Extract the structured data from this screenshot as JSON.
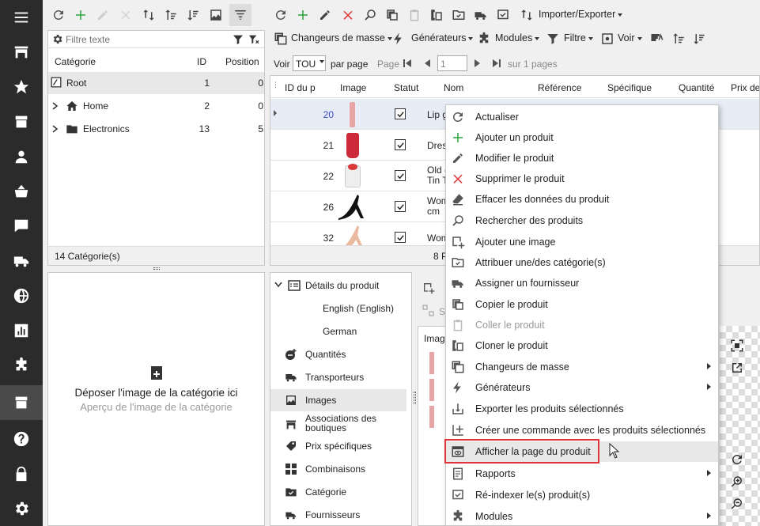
{
  "nav": {
    "items": [
      "menu-icon",
      "store-icon",
      "star-icon",
      "box-icon",
      "user-icon",
      "basket-icon",
      "chat-icon",
      "truck-icon",
      "globe-icon",
      "chart-icon",
      "puzzle-icon",
      "catalog-icon",
      "help-icon",
      "lock-icon",
      "gear-icon"
    ]
  },
  "category_panel": {
    "filter_placeholder": "Filtre texte",
    "columns": {
      "category": "Catégorie",
      "id": "ID",
      "position": "Position"
    },
    "rows": [
      {
        "name": "Root",
        "id": "1",
        "position": "0"
      },
      {
        "name": "Home",
        "id": "2",
        "position": "0"
      },
      {
        "name": "Electronics",
        "id": "13",
        "position": "5"
      }
    ],
    "footer": "14 Catégorie(s)"
  },
  "dropzone": {
    "title": "Déposer l'image de la catégorie ici",
    "subtitle": "Aperçu de l'image de la catégorie"
  },
  "toolbar": {
    "import_export": "Importer/Exporter",
    "mass_changers": "Changeurs de masse",
    "generators": "Générateurs",
    "modules": "Modules",
    "filter": "Filtre",
    "view": "Voir"
  },
  "pager": {
    "see_label": "Voir",
    "per_page_value": "TOU",
    "per_page_label": "par page",
    "page_label": "Page",
    "page_value": "1",
    "of_pages": "sur 1 pages"
  },
  "grid": {
    "columns": {
      "id": "ID du p",
      "image": "Image",
      "status": "Statut",
      "name": "Nom",
      "reference": "Référence",
      "specific": "Spécifique",
      "quantity": "Quantité",
      "price": "Prix de"
    },
    "rows": [
      {
        "id": "20",
        "name": "Lip g"
      },
      {
        "id": "21",
        "name": "Dres"
      },
      {
        "id": "22",
        "name": "Old (\nTin T"
      },
      {
        "id": "26",
        "name": "Wom\ncm"
      },
      {
        "id": "32",
        "name": "Wom"
      }
    ],
    "footer": "8 P"
  },
  "details": {
    "items": [
      "Détails du produit",
      "English (English)",
      "German",
      "Quantités",
      "Transporteurs",
      "Images",
      "Associations des\nboutiques",
      "Prix spécifiques",
      "Combinaisons",
      "Catégorie",
      "Fournisseurs"
    ]
  },
  "image_panel": {
    "header": "Imag",
    "sub_label": "S"
  },
  "context_menu": {
    "items": [
      {
        "label": "Actualiser",
        "icon": "refresh-icon",
        "submenu": false,
        "disabled": false
      },
      {
        "label": "Ajouter un produit",
        "icon": "plus-icon",
        "submenu": false,
        "disabled": false
      },
      {
        "label": "Modifier le produit",
        "icon": "pencil-icon",
        "submenu": false,
        "disabled": false
      },
      {
        "label": "Supprimer le produit",
        "icon": "delete-icon",
        "submenu": false,
        "disabled": false
      },
      {
        "label": "Effacer les données du produit",
        "icon": "eraser-icon",
        "submenu": false,
        "disabled": false
      },
      {
        "label": "Rechercher des produits",
        "icon": "search-icon",
        "submenu": false,
        "disabled": false
      },
      {
        "label": "Ajouter une image",
        "icon": "add-image-icon",
        "submenu": false,
        "disabled": false
      },
      {
        "label": "Attribuer une/des catégorie(s)",
        "icon": "category-assign-icon",
        "submenu": false,
        "disabled": false
      },
      {
        "label": "Assigner un fournisseur",
        "icon": "supplier-icon",
        "submenu": false,
        "disabled": false
      },
      {
        "label": "Copier le produit",
        "icon": "copy-icon",
        "submenu": false,
        "disabled": false
      },
      {
        "label": "Coller le produit",
        "icon": "paste-icon",
        "submenu": false,
        "disabled": true
      },
      {
        "label": "Cloner le produit",
        "icon": "clone-icon",
        "submenu": false,
        "disabled": false
      },
      {
        "label": "Changeurs de masse",
        "icon": "mass-change-icon",
        "submenu": true,
        "disabled": false
      },
      {
        "label": "Générateurs",
        "icon": "lightning-icon",
        "submenu": true,
        "disabled": false
      },
      {
        "label": "Exporter les produits sélectionnés",
        "icon": "export-icon",
        "submenu": false,
        "disabled": false
      },
      {
        "label": "Créer une commande avec les produits sélectionnés",
        "icon": "order-icon",
        "submenu": false,
        "disabled": false
      },
      {
        "label": "Afficher la page du produit",
        "icon": "view-page-icon",
        "submenu": false,
        "disabled": false
      },
      {
        "label": "Rapports",
        "icon": "report-icon",
        "submenu": true,
        "disabled": false
      },
      {
        "label": "Ré-indexer le(s) produit(s)",
        "icon": "reindex-icon",
        "submenu": false,
        "disabled": false
      },
      {
        "label": "Modules",
        "icon": "puzzle-icon",
        "submenu": true,
        "disabled": false
      }
    ]
  },
  "colors": {
    "nav_bg": "#2b2b2b",
    "green": "#2aa63a",
    "red": "#e0343a",
    "highlight": "#e0343a"
  }
}
